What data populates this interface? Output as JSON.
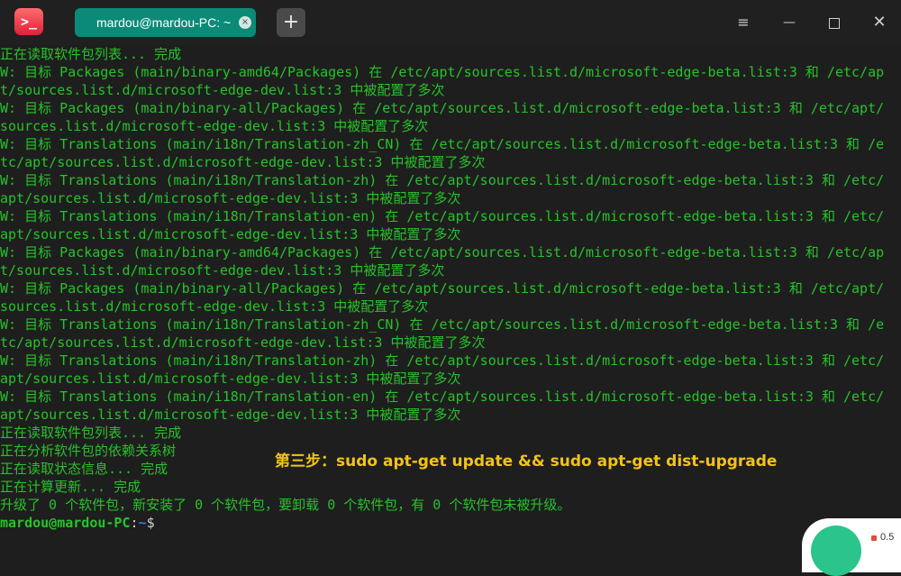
{
  "window": {
    "tab_title": "mardou@mardou-PC: ~",
    "tab_close_glyph": "×",
    "new_tab_glyph": "+",
    "menu_glyph": "≡",
    "minimize_glyph": "—",
    "close_glyph": "✕",
    "app_icon_glyph": ">_"
  },
  "terminal": {
    "lines": [
      "正在读取软件包列表... 完成",
      "W: 目标 Packages (main/binary-amd64/Packages) 在 /etc/apt/sources.list.d/microsoft-edge-beta.list:3 和 /etc/ap",
      "t/sources.list.d/microsoft-edge-dev.list:3 中被配置了多次",
      "W: 目标 Packages (main/binary-all/Packages) 在 /etc/apt/sources.list.d/microsoft-edge-beta.list:3 和 /etc/apt/",
      "sources.list.d/microsoft-edge-dev.list:3 中被配置了多次",
      "W: 目标 Translations (main/i18n/Translation-zh_CN) 在 /etc/apt/sources.list.d/microsoft-edge-beta.list:3 和 /e",
      "tc/apt/sources.list.d/microsoft-edge-dev.list:3 中被配置了多次",
      "W: 目标 Translations (main/i18n/Translation-zh) 在 /etc/apt/sources.list.d/microsoft-edge-beta.list:3 和 /etc/",
      "apt/sources.list.d/microsoft-edge-dev.list:3 中被配置了多次",
      "W: 目标 Translations (main/i18n/Translation-en) 在 /etc/apt/sources.list.d/microsoft-edge-beta.list:3 和 /etc/",
      "apt/sources.list.d/microsoft-edge-dev.list:3 中被配置了多次",
      "W: 目标 Packages (main/binary-amd64/Packages) 在 /etc/apt/sources.list.d/microsoft-edge-beta.list:3 和 /etc/ap",
      "t/sources.list.d/microsoft-edge-dev.list:3 中被配置了多次",
      "W: 目标 Packages (main/binary-all/Packages) 在 /etc/apt/sources.list.d/microsoft-edge-beta.list:3 和 /etc/apt/",
      "sources.list.d/microsoft-edge-dev.list:3 中被配置了多次",
      "W: 目标 Translations (main/i18n/Translation-zh_CN) 在 /etc/apt/sources.list.d/microsoft-edge-beta.list:3 和 /e",
      "tc/apt/sources.list.d/microsoft-edge-dev.list:3 中被配置了多次",
      "W: 目标 Translations (main/i18n/Translation-zh) 在 /etc/apt/sources.list.d/microsoft-edge-beta.list:3 和 /etc/",
      "apt/sources.list.d/microsoft-edge-dev.list:3 中被配置了多次",
      "W: 目标 Translations (main/i18n/Translation-en) 在 /etc/apt/sources.list.d/microsoft-edge-beta.list:3 和 /etc/",
      "apt/sources.list.d/microsoft-edge-dev.list:3 中被配置了多次",
      "正在读取软件包列表... 完成",
      "正在分析软件包的依赖关系树",
      "正在读取状态信息... 完成",
      "正在计算更新... 完成",
      "升级了 0 个软件包，新安装了 0 个软件包，要卸载 0 个软件包，有 0 个软件包未被升级。"
    ],
    "prompt": {
      "user_host": "mardou@mardou-PC",
      "separator": ":",
      "path": "~",
      "symbol": "$"
    }
  },
  "overlay": {
    "caption": "第三步：sudo apt-get update && sudo apt-get dist-upgrade",
    "widget_text": "0.5"
  },
  "colors": {
    "terminal_bg": "#1e1e1e",
    "text_green": "#27c22a",
    "tab_accent": "#0c8a78",
    "caption_yellow": "#f2c318",
    "path_blue": "#3a7be0"
  }
}
